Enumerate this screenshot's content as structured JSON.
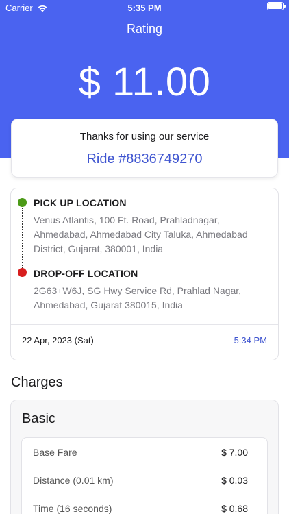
{
  "status_bar": {
    "carrier": "Carrier",
    "time": "5:35 PM"
  },
  "header": {
    "title": "Rating",
    "amount": "$ 11.00",
    "background_color": "#4a63f0"
  },
  "thanks_card": {
    "message": "Thanks for using our service",
    "ride_id": "Ride #8836749270"
  },
  "trip": {
    "pickup": {
      "label": "PICK UP LOCATION",
      "address": "Venus Atlantis, 100 Ft. Road, Prahladnagar, Ahmedabad, Ahmedabad City Taluka, Ahmedabad District, Gujarat, 380001, India",
      "marker_color": "#4c9a18"
    },
    "dropoff": {
      "label": "DROP-OFF LOCATION",
      "address": "2G63+W6J, SG Hwy Service Rd, Prahlad Nagar, Ahmedabad, Gujarat 380015, India",
      "marker_color": "#d71e1e"
    },
    "date": "22 Apr, 2023 (Sat)",
    "time": "5:34 PM"
  },
  "charges": {
    "title": "Charges",
    "section": "Basic",
    "items": [
      {
        "label": "Base Fare",
        "value": "$ 7.00"
      },
      {
        "label": "Distance (0.01 km)",
        "value": "$ 0.03"
      },
      {
        "label": "Time (16 seconds)",
        "value": "$ 0.68"
      }
    ]
  }
}
